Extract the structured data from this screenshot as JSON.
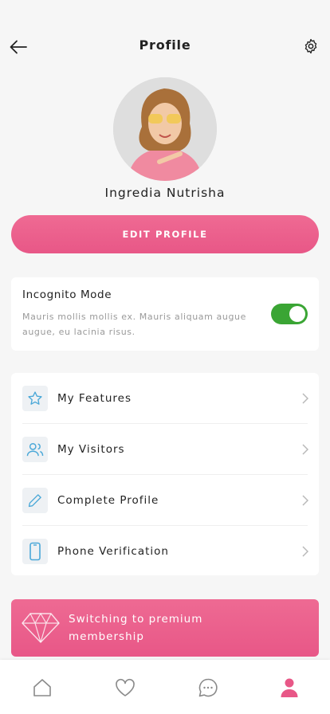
{
  "header": {
    "title": "Profile",
    "back_icon": "arrow-left-icon",
    "settings_icon": "gear-icon"
  },
  "profile": {
    "name": "Ingredia Nutrisha",
    "edit_label": "EDIT PROFILE"
  },
  "incognito": {
    "title": "Incognito Mode",
    "description": "Mauris mollis mollis ex. Mauris aliquam augue augue, eu lacinia risus.",
    "enabled": true
  },
  "menu": {
    "items": [
      {
        "label": "My Features",
        "icon": "star-icon"
      },
      {
        "label": "My Visitors",
        "icon": "users-icon"
      },
      {
        "label": "Complete Profile",
        "icon": "pencil-icon"
      },
      {
        "label": "Phone Verification",
        "icon": "phone-icon"
      }
    ]
  },
  "premium": {
    "text": "Switching to premium membership",
    "icon": "diamond-icon"
  },
  "tabs": [
    {
      "name": "home",
      "icon": "home-icon",
      "active": false
    },
    {
      "name": "likes",
      "icon": "heart-icon",
      "active": false
    },
    {
      "name": "messages",
      "icon": "chat-icon",
      "active": false
    },
    {
      "name": "profile",
      "icon": "user-icon",
      "active": true
    }
  ],
  "colors": {
    "accent": "#e85787",
    "toggle_on": "#3aa534",
    "icon_blue": "#4aa8d8",
    "background": "#f6f6f6"
  }
}
